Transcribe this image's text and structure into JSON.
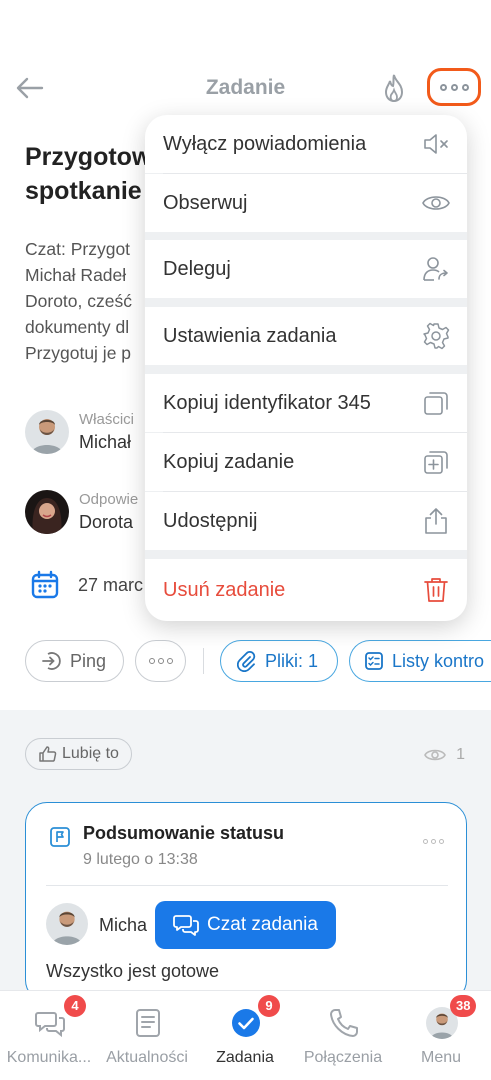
{
  "header": {
    "title": "Zadanie"
  },
  "task": {
    "title_lines": [
      "Przygotow",
      "spotkanie"
    ],
    "desc_lines": [
      "Czat: Przygot",
      "Michał Radeł",
      "Doroto, cześć",
      "dokumenty dl",
      "Przygotuj je p"
    ]
  },
  "people": [
    {
      "role": "Właścici",
      "name": "Michał"
    },
    {
      "role": "Odpowie",
      "name": "Dorota"
    }
  ],
  "date": "27 marc",
  "actions": {
    "ping": "Ping",
    "files": "Pliki: 1",
    "lists": "Listy kontro"
  },
  "feed": {
    "like": "Lubię to",
    "views": "1",
    "card": {
      "title": "Podsumowanie statusu",
      "date": "9 lutego o 13:38",
      "author": "Micha",
      "message": "Wszystko jest gotowe"
    },
    "chat_button": "Czat zadania"
  },
  "menu": {
    "items": [
      {
        "label": "Wyłącz powiadomienia",
        "icon": "mute-icon"
      },
      {
        "label": "Obserwuj",
        "icon": "eye-icon"
      },
      {
        "label": "Deleguj",
        "icon": "delegate-icon"
      },
      {
        "label": "Ustawienia zadania",
        "icon": "gear-icon"
      },
      {
        "label": "Kopiuj identyfikator 345",
        "icon": "copy-icon"
      },
      {
        "label": "Kopiuj zadanie",
        "icon": "copy-plus-icon"
      },
      {
        "label": "Udostępnij",
        "icon": "share-icon"
      },
      {
        "label": "Usuń zadanie",
        "icon": "trash-icon"
      }
    ]
  },
  "nav": {
    "items": [
      {
        "label": "Komunika...",
        "badge": "4"
      },
      {
        "label": "Aktualności",
        "badge": ""
      },
      {
        "label": "Zadania",
        "badge": "9"
      },
      {
        "label": "Połączenia",
        "badge": ""
      },
      {
        "label": "Menu",
        "badge": "38"
      }
    ]
  },
  "colors": {
    "accent": "#1a79e8",
    "highlight": "#f25a1a",
    "danger": "#e74c3c",
    "badge": "#f04b4b"
  }
}
